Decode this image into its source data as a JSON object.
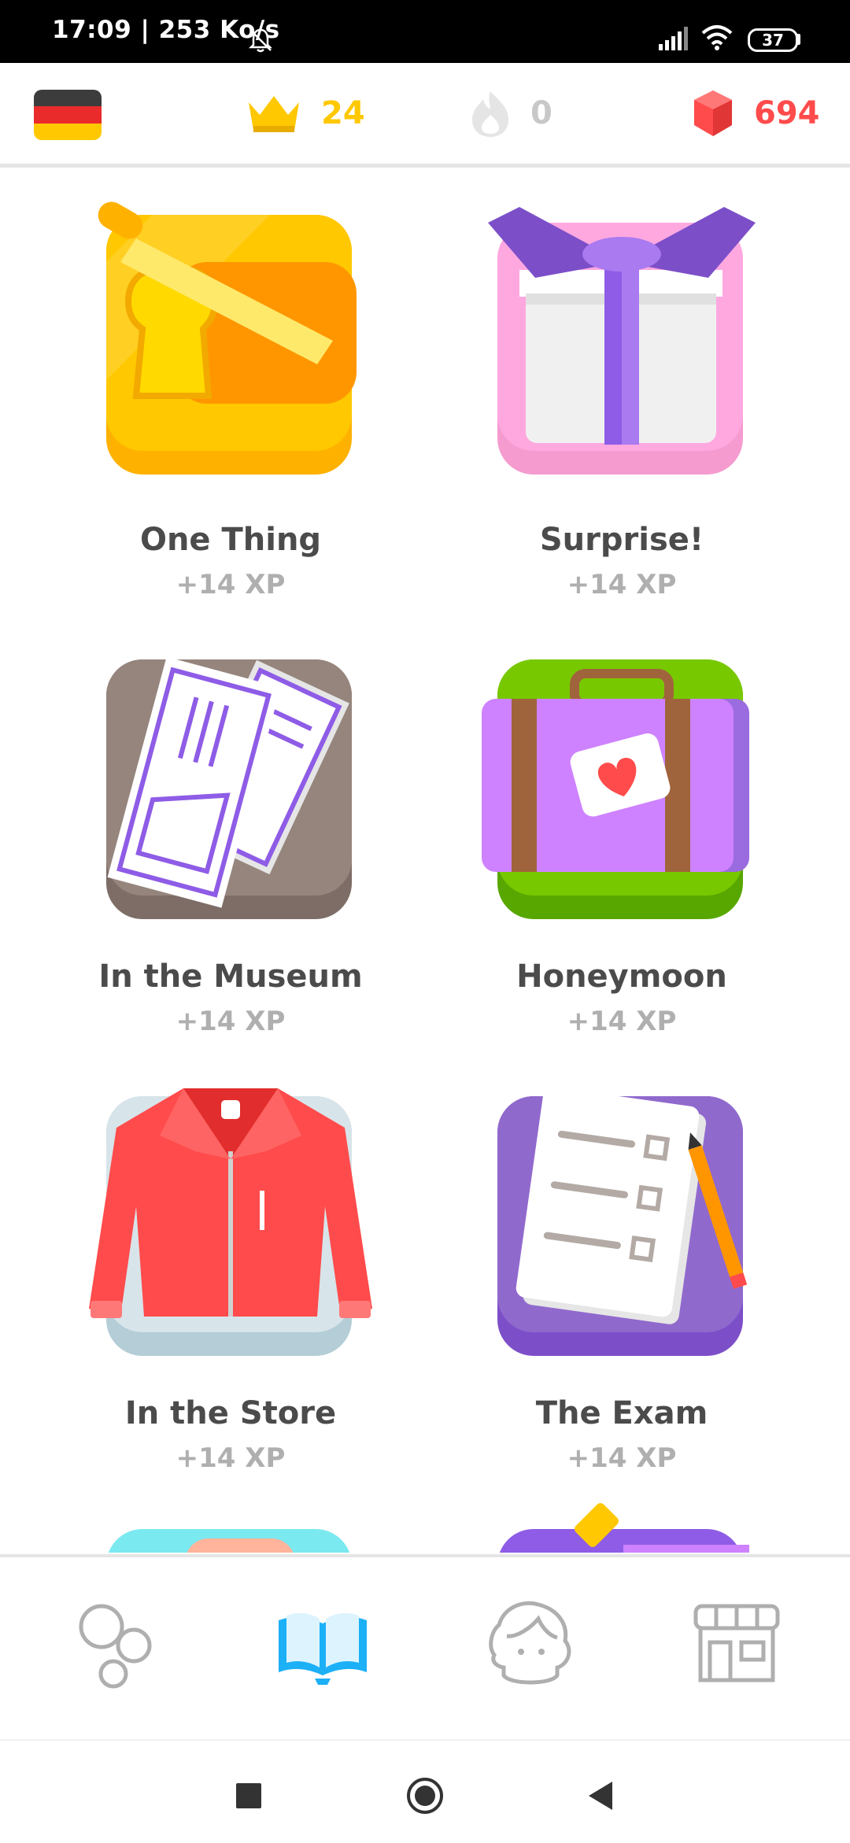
{
  "status_bar": {
    "time": "17:09 | 253 Ko/s",
    "battery": "37"
  },
  "top_bar": {
    "language_flag": "germany-flag-icon",
    "crowns": "24",
    "streak": "0",
    "gems": "694",
    "colors": {
      "crown": "#ffc800",
      "streak": "#c8c8c8",
      "gems": "#ff4b4b"
    }
  },
  "stories": [
    {
      "title": "One Thing",
      "xp": "+14 XP",
      "icon": "toast-icon"
    },
    {
      "title": "Surprise!",
      "xp": "+14 XP",
      "icon": "gift-icon"
    },
    {
      "title": "In the Museum",
      "xp": "+14 XP",
      "icon": "tickets-icon"
    },
    {
      "title": "Honeymoon",
      "xp": "+14 XP",
      "icon": "suitcase-icon"
    },
    {
      "title": "In the Store",
      "xp": "+14 XP",
      "icon": "jacket-icon"
    },
    {
      "title": "The Exam",
      "xp": "+14 XP",
      "icon": "exam-icon"
    }
  ],
  "bottom_nav": {
    "items": [
      "learn-icon",
      "stories-icon",
      "profile-icon",
      "shop-icon"
    ],
    "active": "stories-icon",
    "active_color": "#1cb0f6"
  },
  "system_nav": [
    "recents-icon",
    "home-icon",
    "back-icon"
  ]
}
